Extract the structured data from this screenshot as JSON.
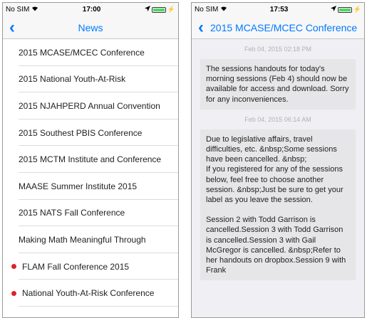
{
  "left": {
    "status": {
      "carrier": "No SIM",
      "time": "17:00"
    },
    "nav": {
      "title": "News"
    },
    "items": [
      {
        "label": "2015 MCASE/MCEC Conference"
      },
      {
        "label": "2015 National Youth-At-Risk"
      },
      {
        "label": "2015 NJAHPERD Annual Convention"
      },
      {
        "label": "2015 Southest PBIS Conference"
      },
      {
        "label": "2015 MCTM Institute and Conference"
      },
      {
        "label": "MAASE Summer Institute 2015"
      },
      {
        "label": "2015 NATS Fall Conference"
      },
      {
        "label": "Making Math Meaningful Through"
      },
      {
        "label": "FLAM Fall Conference 2015",
        "unread": true
      },
      {
        "label": "National Youth-At-Risk Conference",
        "unread": true
      }
    ]
  },
  "right": {
    "status": {
      "carrier": "No SIM",
      "time": "17:53"
    },
    "nav": {
      "title": "2015 MCASE/MCEC Conference"
    },
    "messages": [
      {
        "date": "Feb 04, 2015 02:18 PM",
        "paragraphs": [
          "The sessions handouts for today's morning sessions (Feb 4) should now be available for access and download. Sorry for any inconveniences."
        ]
      },
      {
        "date": "Feb 04, 2015 06:14 AM",
        "paragraphs": [
          "Due to legislative affairs, travel difficulties, etc. &nbsp;Some sessions have been cancelled. &nbsp;\nIf you registered for any of the sessions below, feel free to choose another session. &nbsp;Just be sure to get your label as you leave the session.",
          "Session 2 with Todd Garrison is cancelled.Session 3 with Todd Garrison is cancelled.Session 3 with Gail McGregor is cancelled. &nbsp;Refer to her handouts on dropbox.Session 9 with Frank"
        ]
      }
    ]
  },
  "colors": {
    "accent": "#007aff",
    "unread_dot": "#e0202a",
    "bubble": "#e6e6e8",
    "battery": "#4cd964"
  },
  "icons": {
    "wifi": "wifi-icon",
    "location": "location-arrow-icon",
    "battery": "battery-icon",
    "back": "back-chevron-icon"
  }
}
